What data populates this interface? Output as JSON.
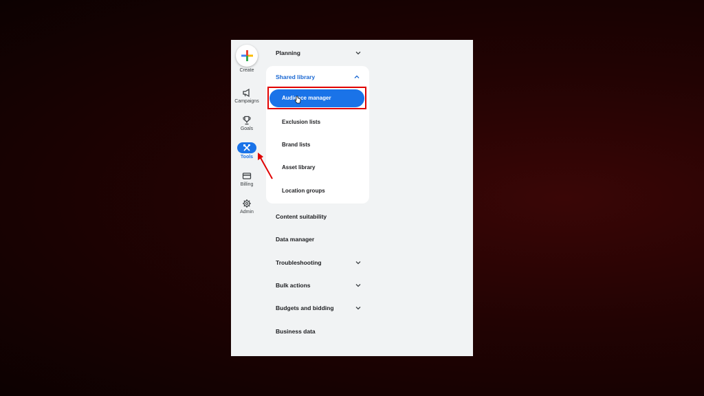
{
  "rail": {
    "create": {
      "label": "Create",
      "icon": "plus-icon"
    },
    "items": [
      {
        "label": "Campaigns",
        "icon": "megaphone-icon"
      },
      {
        "label": "Goals",
        "icon": "trophy-icon"
      },
      {
        "label": "Tools",
        "icon": "tools-icon",
        "active": true
      },
      {
        "label": "Billing",
        "icon": "credit-card-icon"
      },
      {
        "label": "Admin",
        "icon": "gear-icon"
      }
    ]
  },
  "menu": {
    "planning": "Planning",
    "shared_library": {
      "label": "Shared library",
      "items": [
        "Audience manager",
        "Exclusion lists",
        "Brand lists",
        "Asset library",
        "Location groups"
      ],
      "selected": "Audience manager"
    },
    "content_suitability": "Content suitability",
    "data_manager": "Data manager",
    "troubleshooting": "Troubleshooting",
    "bulk_actions": "Bulk actions",
    "budgets_and_bidding": "Budgets and bidding",
    "business_data": "Business data"
  },
  "colors": {
    "accent": "#1a73e8",
    "highlight": "#e00000",
    "panel_bg": "#f1f3f4"
  }
}
